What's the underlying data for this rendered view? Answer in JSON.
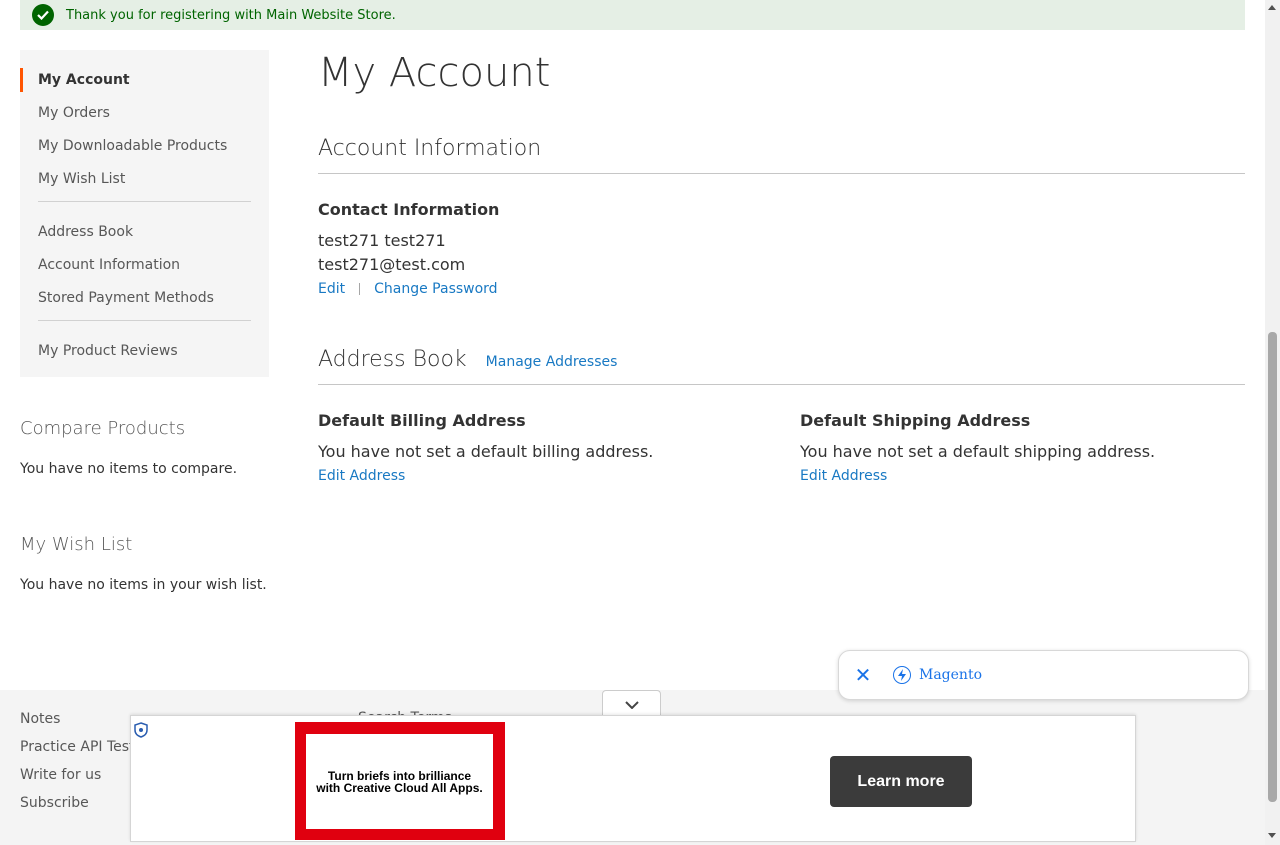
{
  "message": {
    "text": "Thank you for registering with Main Website Store."
  },
  "sidebar": {
    "groups": [
      [
        "My Account",
        "My Orders",
        "My Downloadable Products",
        "My Wish List"
      ],
      [
        "Address Book",
        "Account Information",
        "Stored Payment Methods"
      ],
      [
        "My Product Reviews"
      ]
    ]
  },
  "compare": {
    "title": "Compare Products",
    "empty": "You have no items to compare."
  },
  "wishlist": {
    "title": "My Wish List",
    "empty": "You have no items in your wish list."
  },
  "main": {
    "page_title": "My Account",
    "account_info": {
      "title": "Account Information",
      "contact_title": "Contact Information",
      "name": "test271 test271",
      "email": "test271@test.com",
      "edit": "Edit",
      "change_password": "Change Password"
    },
    "address_book": {
      "title": "Address Book",
      "manage": "Manage Addresses",
      "billing_title": "Default Billing Address",
      "billing_text": "You have not set a default billing address.",
      "shipping_title": "Default Shipping Address",
      "shipping_text": "You have not set a default shipping address.",
      "edit_address": "Edit Address"
    }
  },
  "footer": {
    "links": [
      "Notes",
      "Practice API Testi",
      "Write for us",
      "Subscribe"
    ],
    "partial": "Search Terms"
  },
  "search_chip": {
    "label": "Magento"
  },
  "ad": {
    "creative_line1": "Turn briefs into brilliance",
    "creative_line2": "with Creative Cloud All Apps.",
    "cta": "Learn more"
  }
}
